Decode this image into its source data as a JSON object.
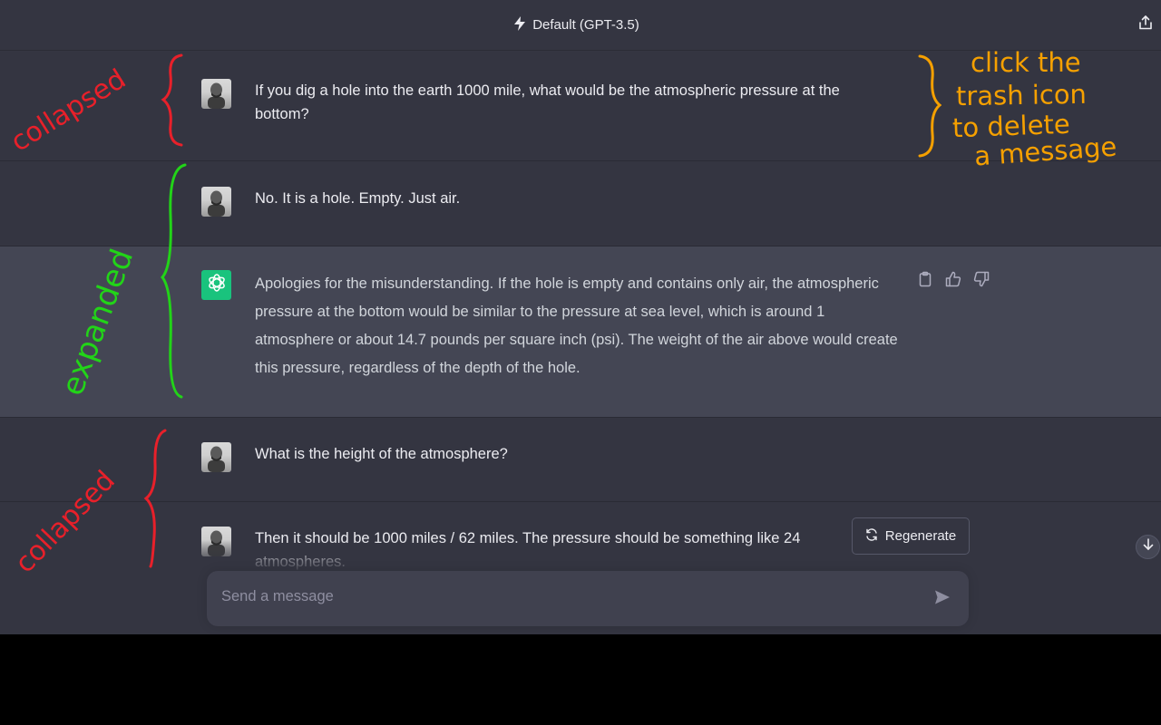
{
  "header": {
    "model_label": "Default (GPT-3.5)",
    "model_icon": "lightning-icon",
    "share_icon": "share-icon"
  },
  "messages": [
    {
      "role": "user",
      "text": "If you dig a hole into the earth 1000 mile, what would be the atmospheric pressure at the bottom?"
    },
    {
      "role": "user",
      "text": "No. It is a hole. Empty. Just air."
    },
    {
      "role": "assistant",
      "text": "Apologies for the misunderstanding. If the hole is empty and contains only air, the atmospheric pressure at the bottom would be similar to the pressure at sea level, which is around 1 atmosphere or about 14.7 pounds per square inch (psi). The weight of the air above would create this pressure, regardless of the depth of the hole."
    },
    {
      "role": "user",
      "text": "What is the height of the atmosphere?"
    },
    {
      "role": "user",
      "text": "Then it should be 1000 miles / 62 miles. The pressure should be something like 24 atmospheres."
    }
  ],
  "assistant_actions": [
    "clipboard-icon",
    "thumbs-up-icon",
    "thumbs-down-icon"
  ],
  "regenerate": {
    "label": "Regenerate",
    "icon": "refresh-icon"
  },
  "composer": {
    "placeholder": "Send a message",
    "send_icon": "send-icon"
  },
  "scroll_icon": "arrow-down-icon",
  "annotations": {
    "top_left": "collapsed",
    "middle_left": "expanded",
    "bottom_left": "collapsed",
    "top_right": [
      "click the",
      "trash icon",
      "to delete",
      "a message"
    ]
  },
  "colors": {
    "background": "#343541",
    "assistant_row": "#444654",
    "composer": "#40414f",
    "gpt_avatar": "#19c37d",
    "annot_red": "#e8202a",
    "annot_green": "#22d418",
    "annot_orange": "#f5a000"
  }
}
